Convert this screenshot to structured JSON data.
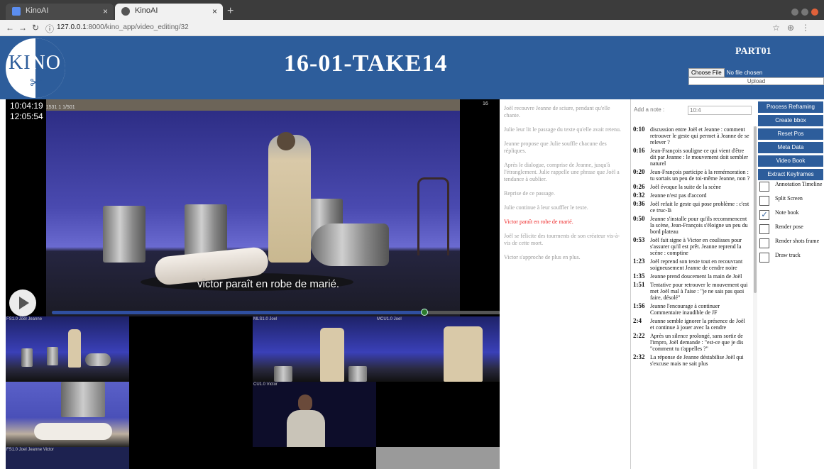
{
  "browser": {
    "tabs": [
      {
        "label": "KinoAI"
      },
      {
        "label": "KinoAI"
      }
    ],
    "new_tab": "+",
    "url_host": "127.0.0.1",
    "url_rest": ":8000/kino_app/video_editing/32"
  },
  "header": {
    "logo_text_left": "KI",
    "logo_text_right": "NO",
    "title": "16-01-TAKE14",
    "part": "PART01",
    "choose_file_label": "Choose File",
    "no_file": "No file chosen",
    "upload_label": "Upload"
  },
  "player": {
    "timecode1": "10:04:19",
    "timecode1_small": "1531   1    1/501",
    "timecode2": "12:05:54",
    "frame_num": "16",
    "subtitle": "victor paraît en robe de marié.",
    "progress": 0.83
  },
  "thumbnails": [
    {
      "label": "FS1.0 Joel Jeanne"
    },
    {
      "label": "MLS1.0 Joel"
    },
    {
      "label": "MCU1.0 Joel"
    },
    {
      "label": "CU1.0 Victor"
    },
    {
      "label": "FS1.0 Joel Jeanne Victor"
    }
  ],
  "script_lines": [
    {
      "text": "Joël recouvre Jeanne de sciure, pendant qu'elle chante.",
      "active": false
    },
    {
      "text": "Julie leur lit le passage du texte qu'elle avait retenu.",
      "active": false
    },
    {
      "text": "Jeanne propose que Julie souffle chacune des répliques.",
      "active": false
    },
    {
      "text": "Après le dialogue, comprise de Jeanne, jusqu'à l'étranglement. Julie rappelle une phrase que Joël a tendance à oublier.",
      "active": false
    },
    {
      "text": "Reprise de ce passage.",
      "active": false
    },
    {
      "text": "Julie continue à leur souffler le texte.",
      "active": false
    },
    {
      "text": "Victor paraît en robe de marié.",
      "active": true
    },
    {
      "text": "Joël se félicite des tourments de son créateur vis-à-vis de cette mort.",
      "active": false
    },
    {
      "text": "Victor s'approche de plus en plus.",
      "active": false
    }
  ],
  "notes_panel": {
    "add_label": "Add a note :",
    "add_value": "10:4",
    "notes": [
      {
        "time": "0:10",
        "text": "discussion entre Joël et Jeanne : comment retrouver le geste qui permet à Jeanne de se relever ?"
      },
      {
        "time": "0:16",
        "text": "Jean-François souligne ce qui vient d'être dit par Jeanne : le mouvement doit sembler naturel"
      },
      {
        "time": "0:20",
        "text": "Jean-François participe à la remémoration : tu sortais un peu de toi-même Jeanne, non ?"
      },
      {
        "time": "0:26",
        "text": "Joël évoque la suite de la scène"
      },
      {
        "time": "0:32",
        "text": "Jeanne n'est pas d'accord"
      },
      {
        "time": "0:36",
        "text": "Joël refait le geste qui pose problème : c'est ce truc-là"
      },
      {
        "time": "0:50",
        "text": "Jeanne s'installe pour qu'ils recommencent la scène, Jean-François s'éloigne un peu du bord plateau"
      },
      {
        "time": "0:53",
        "text": "Joël fait signe à Victor en coulisses pour s'assurer qu'il est prêt. Jeanne reprend la scène : comptine"
      },
      {
        "time": "1:23",
        "text": "Joël reprend son texte tout en recouvrant soigneusement Jeanne de cendre noire"
      },
      {
        "time": "1:35",
        "text": "Jeanne prend doucement la main de Joël"
      },
      {
        "time": "1:51",
        "text": "Tentative pour retrouver le mouvement qui met Joël mal à l'aise : \"je ne sais pas quoi faire, désolé\""
      },
      {
        "time": "1:56",
        "text": "Jeanne l'encourage à continuer Commentaire inaudible de JF"
      },
      {
        "time": "2:4",
        "text": "Jeanne semble ignorer la présence de Joël et continue à jouer avec la cendre"
      },
      {
        "time": "2:22",
        "text": "Après un silence prolongé, sans sortie de l'impro, Joël demande : \"est-ce que je dis \"comment tu t'appelles ?\""
      },
      {
        "time": "2:32",
        "text": "La réponse de Jeanne déstabilise Joël qui s'excuse mais ne sait plus"
      }
    ]
  },
  "actions": {
    "buttons": [
      "Process Reframing",
      "Create bbox",
      "Reset Pos",
      "Meta Data",
      "Video Book",
      "Extract Keyframes"
    ],
    "checkboxes": [
      {
        "label": "Annotation Timeline",
        "checked": false
      },
      {
        "label": "Split Screen",
        "checked": false
      },
      {
        "label": "Note book",
        "checked": true
      },
      {
        "label": "Render pose",
        "checked": false
      },
      {
        "label": "Render shots frame",
        "checked": false
      },
      {
        "label": "Draw track",
        "checked": false
      }
    ]
  },
  "colors": {
    "brand": "#2d5d9b",
    "active_line": "#ee2a2a"
  }
}
